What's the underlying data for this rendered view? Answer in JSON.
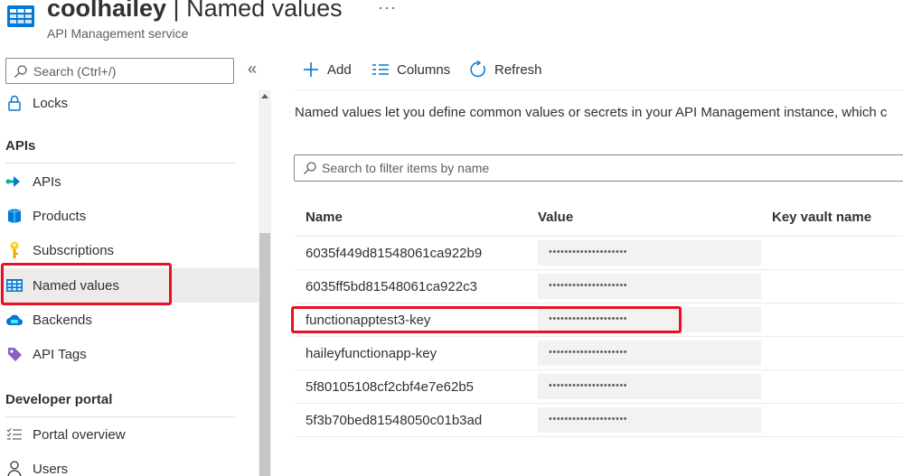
{
  "header": {
    "resource_name": "coolhailey",
    "separator": " | ",
    "page_title": "Named values",
    "more_label": "···",
    "subtitle": "API Management service",
    "resource_icon": "api-management-grid-icon"
  },
  "sidebar": {
    "search_placeholder": "Search (Ctrl+/)",
    "collapse_label": "«",
    "items_top": [
      {
        "label": "Locks",
        "icon": "lock-icon"
      }
    ],
    "sections": [
      {
        "title": "APIs",
        "items": [
          {
            "label": "APIs",
            "icon": "api-arrow-icon"
          },
          {
            "label": "Products",
            "icon": "product-cube-icon"
          },
          {
            "label": "Subscriptions",
            "icon": "key-icon"
          },
          {
            "label": "Named values",
            "icon": "named-values-grid-icon",
            "selected": true
          },
          {
            "label": "Backends",
            "icon": "cloud-icon"
          },
          {
            "label": "API Tags",
            "icon": "tag-icon"
          }
        ]
      },
      {
        "title": "Developer portal",
        "items": [
          {
            "label": "Portal overview",
            "icon": "list-check-icon"
          },
          {
            "label": "Users",
            "icon": "user-icon"
          }
        ]
      }
    ]
  },
  "toolbar": {
    "add_label": "Add",
    "columns_label": "Columns",
    "refresh_label": "Refresh"
  },
  "description": "Named values let you define common values or secrets in your API Management instance, which c",
  "filter": {
    "placeholder": "Search to filter items by name"
  },
  "table": {
    "columns": [
      "Name",
      "Value",
      "Key vault name"
    ],
    "rows": [
      {
        "name": "6035f449d81548061ca922b9",
        "value": "••••••••••••••••••••"
      },
      {
        "name": "6035ff5bd81548061ca922c3",
        "value": "••••••••••••••••••••"
      },
      {
        "name": "functionapptest3-key",
        "value": "••••••••••••••••••••"
      },
      {
        "name": "haileyfunctionapp-key",
        "value": "••••••••••••••••••••"
      },
      {
        "name": "5f80105108cf2cbf4e7e62b5",
        "value": "••••••••••••••••••••"
      },
      {
        "name": "5f3b70bed81548050c01b3ad",
        "value": "••••••••••••••••••••"
      }
    ]
  },
  "colors": {
    "accent": "#0078d4",
    "highlight": "#e81123",
    "selected_bg": "#edebe9"
  }
}
